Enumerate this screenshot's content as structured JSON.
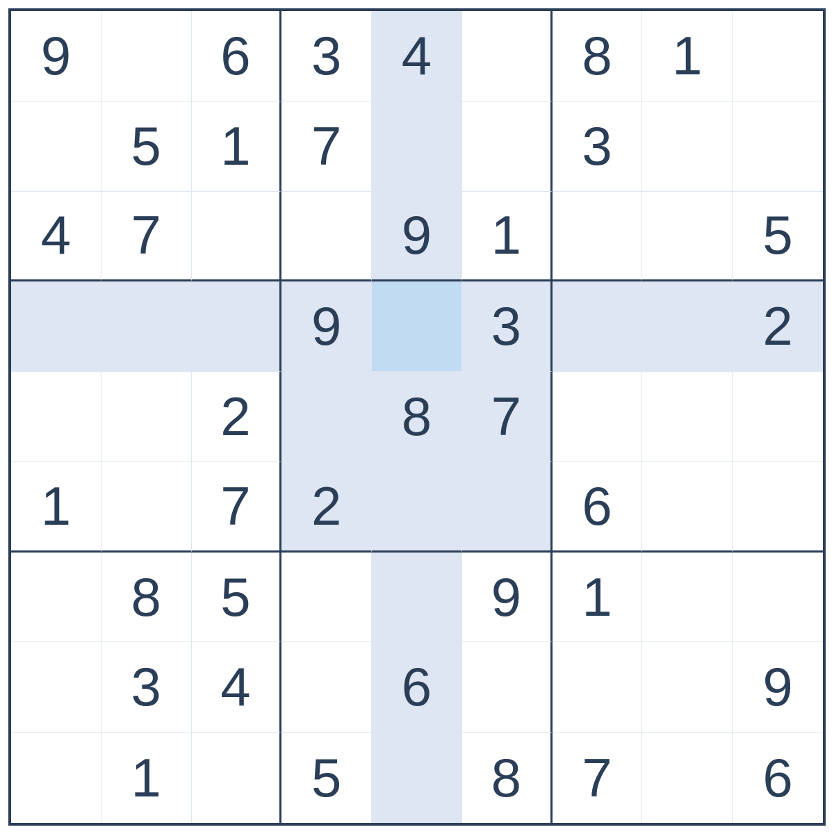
{
  "sudoku": {
    "grid": [
      [
        "9",
        "",
        "6",
        "3",
        "4",
        "",
        "8",
        "1",
        ""
      ],
      [
        "",
        "5",
        "1",
        "7",
        "",
        "",
        "3",
        "",
        ""
      ],
      [
        "4",
        "7",
        "",
        "",
        "9",
        "1",
        "",
        "",
        "5"
      ],
      [
        "",
        "",
        "",
        "9",
        "",
        "3",
        "",
        "",
        "2"
      ],
      [
        "",
        "",
        "2",
        "",
        "8",
        "7",
        "",
        "",
        ""
      ],
      [
        "1",
        "",
        "7",
        "2",
        "",
        "",
        "6",
        "",
        ""
      ],
      [
        "",
        "8",
        "5",
        "",
        "",
        "9",
        "1",
        "",
        ""
      ],
      [
        "",
        "3",
        "4",
        "",
        "6",
        "",
        "",
        "",
        "9"
      ],
      [
        "",
        "1",
        "",
        "5",
        "",
        "8",
        "7",
        "",
        "6"
      ]
    ],
    "selected": {
      "row": 3,
      "col": 4
    },
    "colors": {
      "digit": "#2b3e57",
      "thin_line": "#dde6f2",
      "thick_line": "#2b3e57",
      "highlight": "#dde6f2",
      "selected": "#c1dbf2"
    }
  }
}
